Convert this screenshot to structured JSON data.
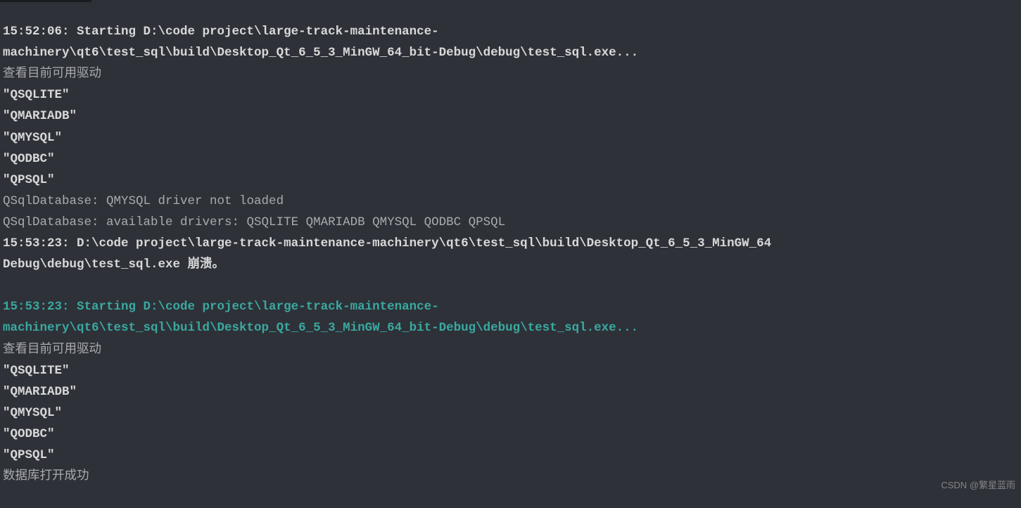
{
  "console": {
    "run1": {
      "start_line1": "15:52:06: Starting D:\\code project\\large-track-maintenance-",
      "start_line2": "machinery\\qt6\\test_sql\\build\\Desktop_Qt_6_5_3_MinGW_64_bit-Debug\\debug\\test_sql.exe...",
      "msg_check": "查看目前可用驱动",
      "drv1": "\"QSQLITE\"",
      "drv2": "\"QMARIADB\"",
      "drv3": "\"QMYSQL\"",
      "drv4": "\"QODBC\"",
      "drv5": "\"QPSQL\"",
      "err1": "QSqlDatabase: QMYSQL driver not loaded",
      "err2": "QSqlDatabase: available drivers: QSQLITE QMARIADB QMYSQL QODBC QPSQL",
      "crash_line1": "15:53:23: D:\\code project\\large-track-maintenance-machinery\\qt6\\test_sql\\build\\Desktop_Qt_6_5_3_MinGW_64",
      "crash_line2": "Debug\\debug\\test_sql.exe 崩溃。"
    },
    "run2": {
      "start_line1": "15:53:23: Starting D:\\code project\\large-track-maintenance-",
      "start_line2": "machinery\\qt6\\test_sql\\build\\Desktop_Qt_6_5_3_MinGW_64_bit-Debug\\debug\\test_sql.exe...",
      "msg_check": "查看目前可用驱动",
      "drv1": "\"QSQLITE\"",
      "drv2": "\"QMARIADB\"",
      "drv3": "\"QMYSQL\"",
      "drv4": "\"QODBC\"",
      "drv5": "\"QPSQL\"",
      "success": "数据库打开成功"
    }
  },
  "watermark": "CSDN @繁星蓝雨"
}
